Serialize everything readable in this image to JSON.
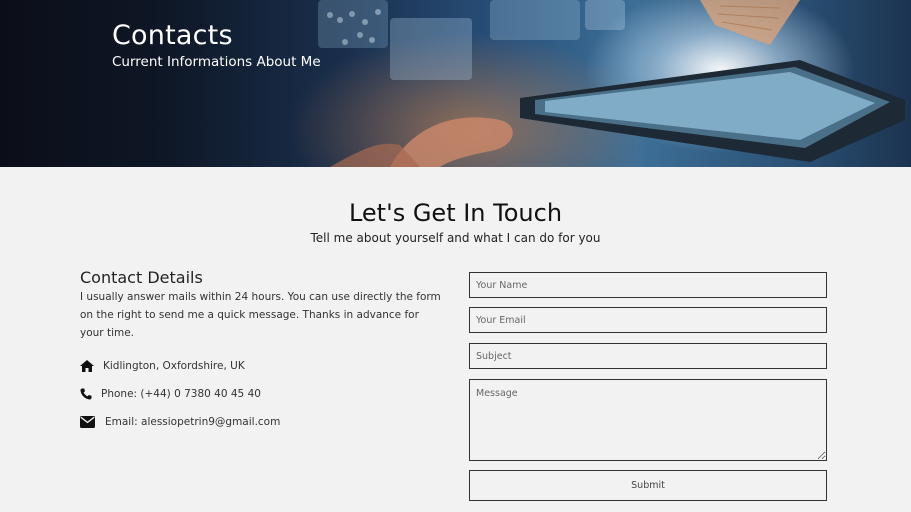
{
  "hero": {
    "title": "Contacts",
    "subtitle": "Current Informations About Me"
  },
  "section": {
    "title": "Let's Get In Touch",
    "subtitle": "Tell me about yourself and what I can do for you"
  },
  "details": {
    "title": "Contact Details",
    "text": "I usually answer mails within 24 hours. You can use directly the form on the right to send me a quick message. Thanks in advance for your time.",
    "address": "Kidlington, Oxfordshire, UK",
    "phone": "Phone: (+44) 0 7380 40 45 40",
    "email": "Email: alessiopetrin9@gmail.com",
    "icons": [
      "home-icon",
      "phone-icon",
      "envelope-icon"
    ]
  },
  "form": {
    "name_placeholder": "Your Name",
    "email_placeholder": "Your Email",
    "subject_placeholder": "Subject",
    "message_placeholder": "Message",
    "submit_label": "Submit"
  }
}
